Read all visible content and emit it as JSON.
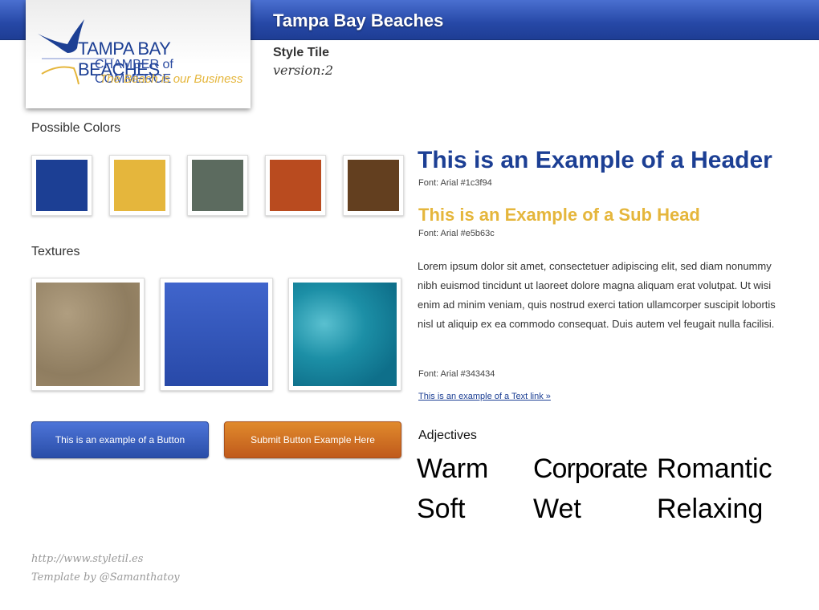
{
  "header": {
    "title": "Tampa Bay Beaches",
    "subtitle": "Style Tile",
    "version": "version:2"
  },
  "logo": {
    "line1": "TAMPA BAY BEACHES",
    "line2": "CHAMBER of COMMERCE",
    "tagline": "The Beach is our Business"
  },
  "colors": {
    "label": "Possible Colors",
    "swatches": [
      "#1c3f94",
      "#e5b63c",
      "#5c6b5f",
      "#b94b1f",
      "#633f1f"
    ]
  },
  "textures": {
    "label": "Textures",
    "items": [
      "sand",
      "blue-gradient",
      "water"
    ]
  },
  "buttons": {
    "primary": "This is an example of a Button",
    "submit": "Submit Button Example Here"
  },
  "typography": {
    "header": "This is an Example of a Header",
    "header_note": "Font: Arial #1c3f94",
    "subhead": "This is an Example of a Sub Head",
    "subhead_note": "Font: Arial #e5b63c",
    "body": "Lorem ipsum dolor sit amet, consectetuer adipiscing elit, sed diam non­ummy nibh euismod tincidunt ut laoreet dolore magna aliquam erat volut­pat. Ut wisi enim ad minim veniam, quis nostrud exerci tation ullamcorper suscipit lobortis nisl ut aliquip ex ea commodo consequat. Duis autem vel feugait nulla facilisi.",
    "body_note": "Font: Arial #343434",
    "link": "This is an example of a Text link »"
  },
  "adjectives": {
    "label": "Adjectives",
    "words": [
      "Warm",
      "Corporate",
      "Romantic",
      "Soft",
      "Wet",
      "Relaxing"
    ]
  },
  "footer": {
    "url": "http://www.styletil.es",
    "credit": "Template by @Samanthatoy"
  }
}
